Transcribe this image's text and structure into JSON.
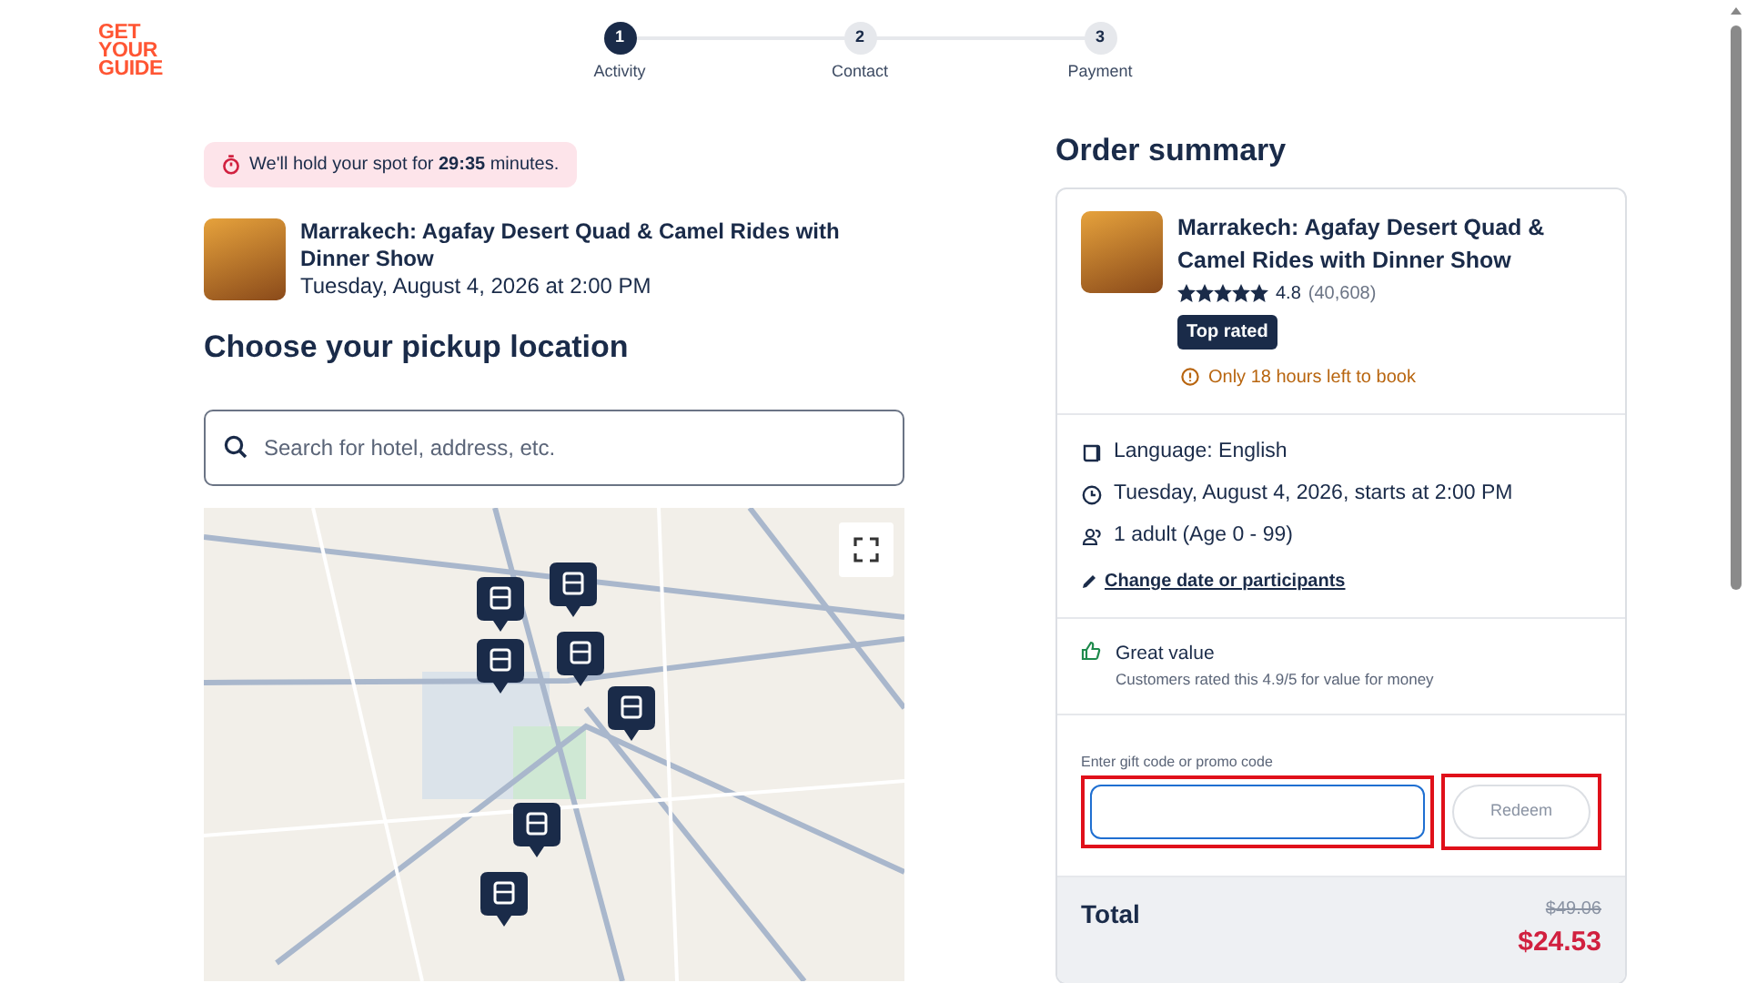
{
  "logo": {
    "lines": [
      "GET",
      "YOUR",
      "GUIDE"
    ]
  },
  "steps": [
    {
      "number": "1",
      "label": "Activity",
      "selected": true
    },
    {
      "number": "2",
      "label": "Contact",
      "selected": false
    },
    {
      "number": "3",
      "label": "Payment",
      "selected": false
    }
  ],
  "timer": {
    "prefix": "We'll hold your spot for ",
    "time": "29:35",
    "suffix": " minutes."
  },
  "activity": {
    "title": "Marrakech: Agafay Desert Quad & Camel Rides with Dinner Show",
    "date": "Tuesday, August 4, 2026 at 2:00 PM"
  },
  "pickup": {
    "heading": "Choose your pickup location",
    "search_placeholder": "Search for hotel, address, etc."
  },
  "summary": {
    "heading": "Order summary",
    "title": "Marrakech: Agafay Desert Quad & Camel Rides with Dinner Show",
    "stars": 5,
    "rating": "4.8",
    "reviews": "(40,608)",
    "badge": "Top rated",
    "urgency": "Only 18 hours left to book",
    "details": [
      {
        "kind": "language",
        "text": "Language: English"
      },
      {
        "kind": "time",
        "text": "Tuesday, August 4, 2026, starts at 2:00 PM"
      },
      {
        "kind": "people",
        "text": "1 adult (Age 0 - 99)"
      }
    ],
    "change_link": "Change date or participants",
    "value": {
      "title": "Great value",
      "text": "Customers rated this 4.9/5 for value for money"
    },
    "promo": {
      "label": "Enter gift code or promo code",
      "highlighted": true,
      "focused": true
    },
    "redeem": {
      "label": "Redeem",
      "disabled": true,
      "highlighted": true
    },
    "total": {
      "label": "Total",
      "old_price": "$49.06",
      "price": "$24.53"
    }
  }
}
